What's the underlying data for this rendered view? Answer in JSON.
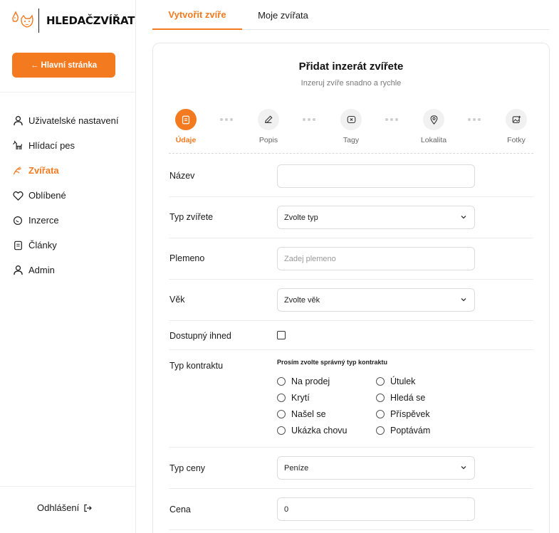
{
  "brand": {
    "name": "HLEDAČZVÍŘAT"
  },
  "sidebar": {
    "home_button": "← Hlavní stránka",
    "items": [
      {
        "label": "Uživatelské nastavení",
        "icon": "user-icon",
        "active": false
      },
      {
        "label": "Hlídací pes",
        "icon": "dog-icon",
        "active": false
      },
      {
        "label": "Zvířata",
        "icon": "paw-icon",
        "active": true
      },
      {
        "label": "Oblíbené",
        "icon": "heart-icon",
        "active": false
      },
      {
        "label": "Inzerce",
        "icon": "chat-icon",
        "active": false
      },
      {
        "label": "Články",
        "icon": "document-icon",
        "active": false
      },
      {
        "label": "Admin",
        "icon": "user-icon",
        "active": false
      }
    ],
    "logout": "Odhlášení"
  },
  "tabs": [
    {
      "label": "Vytvořit zvíře",
      "active": true
    },
    {
      "label": "Moje zvířata",
      "active": false
    }
  ],
  "form": {
    "title": "Přidat inzerát zvířete",
    "subtitle": "Inzeruj zvíře snadno a rychle",
    "steps": [
      {
        "label": "Údaje",
        "icon": "document-icon",
        "active": true
      },
      {
        "label": "Popis",
        "icon": "pencil-icon",
        "active": false
      },
      {
        "label": "Tagy",
        "icon": "tag-icon",
        "active": false
      },
      {
        "label": "Lokalita",
        "icon": "location-pin-icon",
        "active": false
      },
      {
        "label": "Fotky",
        "icon": "image-icon",
        "active": false
      }
    ],
    "fields": {
      "name": {
        "label": "Název",
        "value": ""
      },
      "animal_type": {
        "label": "Typ zvířete",
        "value": "Zvolte typ"
      },
      "breed": {
        "label": "Plemeno",
        "placeholder": "Zadej plemeno"
      },
      "age": {
        "label": "Věk",
        "value": "Zvolte věk"
      },
      "available": {
        "label": "Dostupný ihned",
        "checked": false
      },
      "contract": {
        "label": "Typ kontraktu",
        "hint": "Prosím zvolte správný typ kontraktu",
        "options": [
          "Na prodej",
          "Krytí",
          "Našel se",
          "Ukázka chovu",
          "Útulek",
          "Hledá se",
          "Příspěvek",
          "Poptávám"
        ]
      },
      "price_type": {
        "label": "Typ ceny",
        "value": "Peníze"
      },
      "price": {
        "label": "Cena",
        "value": "0"
      }
    }
  },
  "colors": {
    "accent": "#f47a20",
    "text": "#1a1a1a",
    "muted": "#7a7a7a",
    "border": "#dcdcdc"
  }
}
